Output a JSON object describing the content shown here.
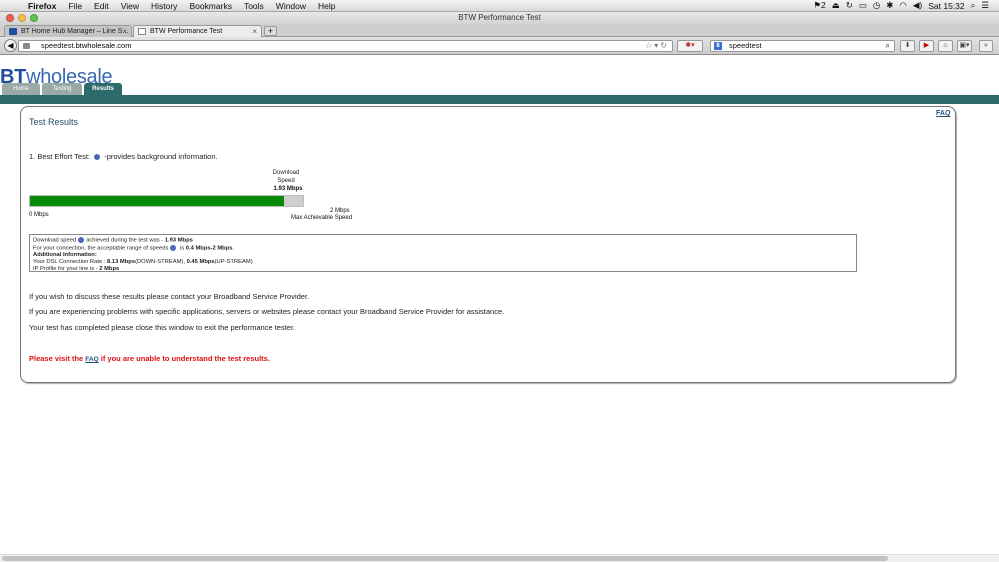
{
  "menubar": {
    "app": "Firefox",
    "items": [
      "File",
      "Edit",
      "View",
      "History",
      "Bookmarks",
      "Tools",
      "Window",
      "Help"
    ],
    "right": {
      "badge": "2",
      "clock": "Sat 15:32"
    }
  },
  "window": {
    "title": "BTW Performance Test"
  },
  "tabs": [
    {
      "label": "BT Home Hub Manager – Line S..."
    },
    {
      "label": "BTW Performance Test"
    }
  ],
  "nav": {
    "url_prefix": "speedtest.",
    "url_host": "btwholesale.com",
    "search_value": "speedtest"
  },
  "site": {
    "logo_bt": "BT",
    "logo_rest": "wholesale",
    "tabs": [
      "Home",
      "Testing",
      "Results"
    ]
  },
  "results": {
    "faq": "FAQ",
    "title": "Test Results",
    "best_effort": "1. Best Effort Test:",
    "best_effort_suffix": "-provides background information.",
    "download_label_1": "Download",
    "download_label_2": "Speed",
    "download_value": "1.93 Mbps",
    "scale_min": "0 Mbps",
    "scale_max": "2 Mbps",
    "scale_max_label": "Max Achievable Speed",
    "progress": {
      "download_mbps": 1.93,
      "max_mbps": 2
    }
  },
  "info": {
    "line1_pre": "Download speed",
    "line1_mid": "achieved during the test was - ",
    "line1_val": "1.93 Mbps",
    "line2_pre": "For your connection, the acceptable range of speeds",
    "line2_mid": " is ",
    "line2_val": "0.4 Mbps-2 Mbps",
    "line2_end": ".",
    "additional": "Additional Information:",
    "line4_pre": "Your DSL Connection Rate :",
    "line4_down": "8.13 Mbps",
    "line4_down_lbl": "(DOWN-STREAM), ",
    "line4_up": "0.45 Mbps",
    "line4_up_lbl": "(UP-STREAM)",
    "line5_pre": "IP Profile for your line is - ",
    "line5_val": "2 Mbps"
  },
  "messages": {
    "p1": "If you wish to discuss these results please contact your Broadband Service Provider.",
    "p2": "If you are experiencing problems with specific applications, servers or websites please contact your Broadband Service Provider for assistance.",
    "p3": "Your test has completed please close this window to exit the performance tester.",
    "visit_pre": "Please visit the ",
    "visit_link": "FAQ",
    "visit_post": " if you are unable to understand the test results."
  }
}
